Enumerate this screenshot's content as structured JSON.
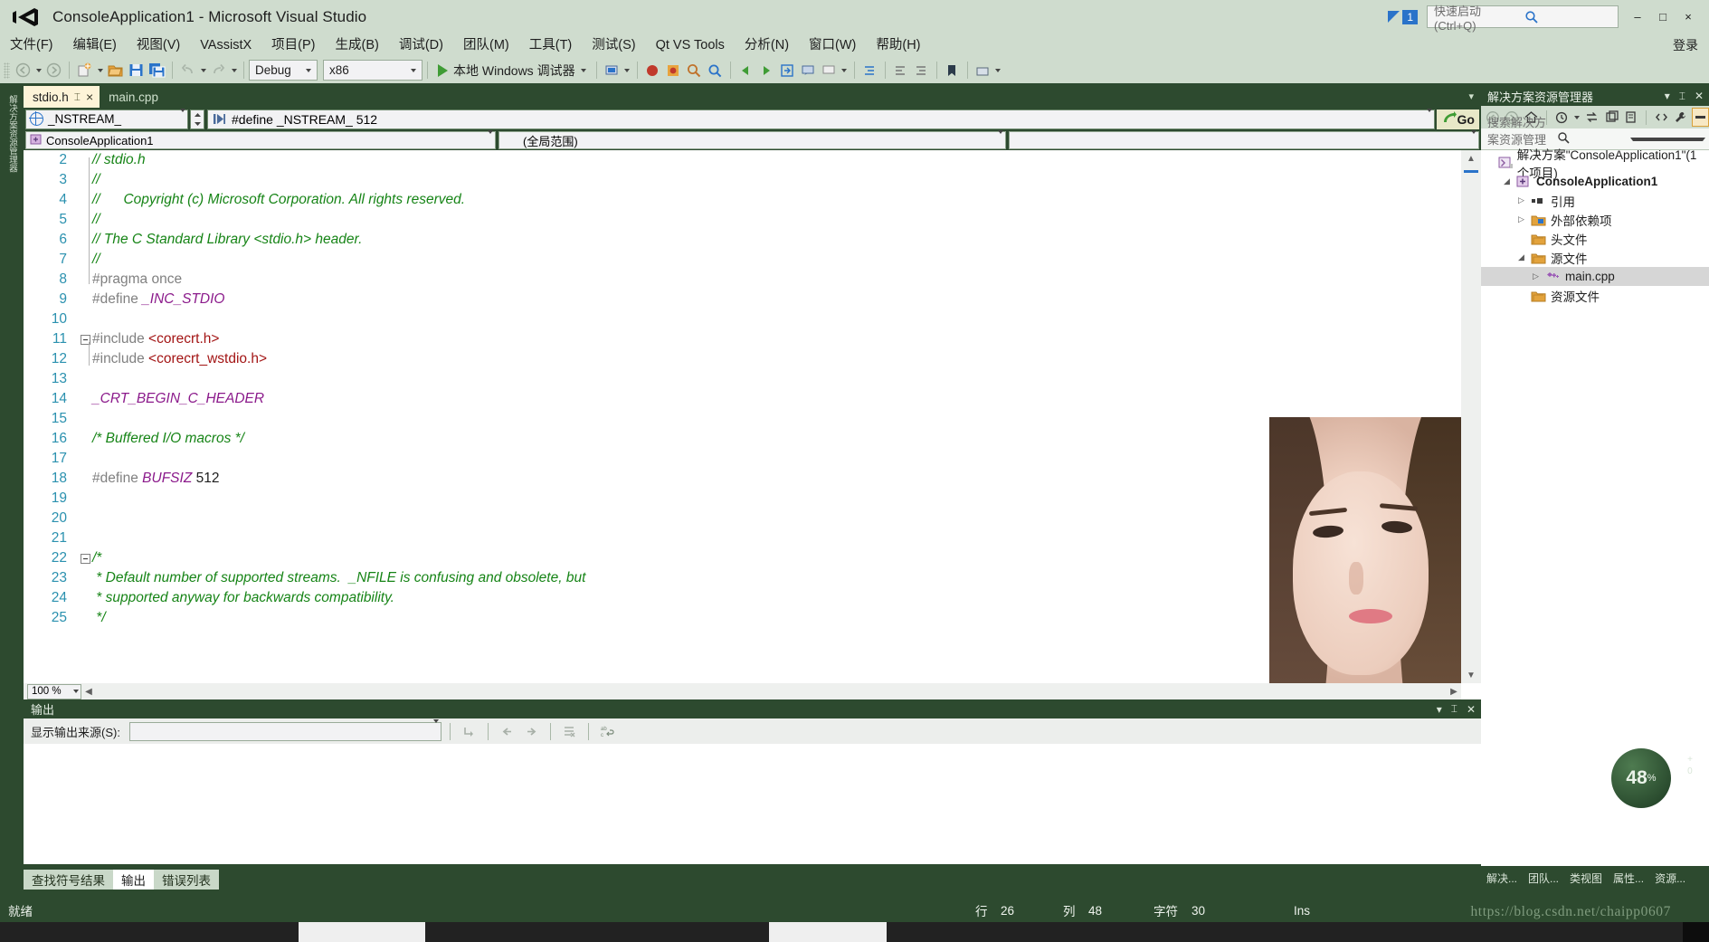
{
  "window": {
    "title": "ConsoleApplication1 - Microsoft Visual Studio",
    "logo_name": "visual-studio-logo",
    "notification_count": "1",
    "minimize": "–",
    "maximize": "□",
    "close": "×",
    "signin": "登录"
  },
  "quick_launch": {
    "placeholder": "快速启动 (Ctrl+Q)",
    "icon": "search-icon"
  },
  "menu": {
    "items": [
      "文件(F)",
      "编辑(E)",
      "视图(V)",
      "VAssistX",
      "项目(P)",
      "生成(B)",
      "调试(D)",
      "团队(M)",
      "工具(T)",
      "测试(S)",
      "Qt VS Tools",
      "分析(N)",
      "窗口(W)",
      "帮助(H)"
    ]
  },
  "toolbar": {
    "config": "Debug",
    "platform": "x86",
    "run_label": "本地 Windows 调试器",
    "icons": [
      "back-icon",
      "forward-icon",
      "new-project-icon",
      "open-file-icon",
      "save-icon",
      "save-all-icon",
      "undo-icon",
      "redo-icon"
    ]
  },
  "doc_tabs": [
    {
      "label": "stdio.h",
      "active": true,
      "pin": "pin-icon",
      "close": "×"
    },
    {
      "label": "main.cpp",
      "active": false
    }
  ],
  "vertical_tab_label": "解决方案资源管理器",
  "navbar": {
    "symbol": "_NSTREAM_",
    "definition": "#define _NSTREAM_ 512",
    "go_label": "Go",
    "project": "ConsoleApplication1",
    "scope": "(全局范围)"
  },
  "editor": {
    "zoom": "100 %",
    "lines": [
      {
        "no": "2",
        "fold": "",
        "parts": [
          {
            "t": "// stdio.h",
            "c": "c-comment"
          }
        ]
      },
      {
        "no": "3",
        "fold": "",
        "parts": [
          {
            "t": "//",
            "c": "c-comment"
          }
        ]
      },
      {
        "no": "4",
        "fold": "",
        "parts": [
          {
            "t": "//      Copyright (c) Microsoft Corporation. All rights reserved.",
            "c": "c-comment"
          }
        ]
      },
      {
        "no": "5",
        "fold": "",
        "parts": [
          {
            "t": "//",
            "c": "c-comment"
          }
        ]
      },
      {
        "no": "6",
        "fold": "",
        "parts": [
          {
            "t": "// The C Standard Library <stdio.h> header.",
            "c": "c-comment"
          }
        ]
      },
      {
        "no": "7",
        "fold": "",
        "parts": [
          {
            "t": "//",
            "c": "c-comment"
          }
        ]
      },
      {
        "no": "8",
        "fold": "",
        "parts": [
          {
            "t": "#pragma once",
            "c": "c-pre"
          }
        ]
      },
      {
        "no": "9",
        "fold": "",
        "parts": [
          {
            "t": "#define ",
            "c": "c-pre"
          },
          {
            "t": "_INC_STDIO",
            "c": "c-macro"
          }
        ]
      },
      {
        "no": "10",
        "fold": "",
        "parts": []
      },
      {
        "no": "11",
        "fold": "⊖",
        "parts": [
          {
            "t": "#include ",
            "c": "c-pre"
          },
          {
            "t": "<corecrt.h>",
            "c": "c-str"
          }
        ]
      },
      {
        "no": "12",
        "fold": "",
        "parts": [
          {
            "t": "#include ",
            "c": "c-pre"
          },
          {
            "t": "<corecrt_wstdio.h>",
            "c": "c-str"
          }
        ]
      },
      {
        "no": "13",
        "fold": "",
        "parts": []
      },
      {
        "no": "14",
        "fold": "",
        "parts": [
          {
            "t": "_CRT_BEGIN_C_HEADER",
            "c": "c-macro"
          }
        ]
      },
      {
        "no": "15",
        "fold": "",
        "parts": []
      },
      {
        "no": "16",
        "fold": "",
        "parts": [
          {
            "t": "/* Buffered I/O macros */",
            "c": "c-comment"
          }
        ]
      },
      {
        "no": "17",
        "fold": "",
        "parts": []
      },
      {
        "no": "18",
        "fold": "",
        "parts": [
          {
            "t": "#define ",
            "c": "c-pre"
          },
          {
            "t": "BUFSIZ",
            "c": "c-macro"
          },
          {
            "t": " 512",
            "c": "c-num"
          }
        ]
      },
      {
        "no": "19",
        "fold": "",
        "parts": []
      },
      {
        "no": "20",
        "fold": "",
        "parts": []
      },
      {
        "no": "21",
        "fold": "",
        "parts": []
      },
      {
        "no": "22",
        "fold": "⊖",
        "parts": [
          {
            "t": "/*",
            "c": "c-comment"
          }
        ]
      },
      {
        "no": "23",
        "fold": "",
        "parts": [
          {
            "t": " * Default number of supported streams.  _NFILE is confusing and obsolete, but",
            "c": "c-comment"
          }
        ]
      },
      {
        "no": "24",
        "fold": "",
        "parts": [
          {
            "t": " * supported anyway for backwards compatibility.",
            "c": "c-comment"
          }
        ]
      },
      {
        "no": "25",
        "fold": "",
        "parts": [
          {
            "t": " */",
            "c": "c-comment"
          }
        ]
      }
    ]
  },
  "output": {
    "title": "输出",
    "source_label": "显示输出来源(S):",
    "source_value": "",
    "tabs": [
      {
        "label": "查找符号结果",
        "active": false
      },
      {
        "label": "输出",
        "active": true
      },
      {
        "label": "错误列表",
        "active": false
      }
    ],
    "toolbar_icons": [
      "jump-to-icon",
      "prev-icon",
      "next-icon",
      "clear-all-icon",
      "word-wrap-icon"
    ]
  },
  "solution_explorer": {
    "title": "解决方案资源管理器",
    "search_placeholder": "搜索解决方案资源管理器(Ctrl+;)",
    "toolbar_icons": [
      "back-icon",
      "forward-icon",
      "home-icon",
      "pending-changes-icon",
      "sync-icon",
      "collapse-all-icon",
      "properties-icon",
      "show-all-files-icon",
      "wrench-icon",
      "preview-icon"
    ],
    "tree": [
      {
        "label": "解决方案\"ConsoleApplication1\"(1 个项目)",
        "indent": 0,
        "twisty": "",
        "icon": "solution-icon",
        "bold": false,
        "selected": false
      },
      {
        "label": "ConsoleApplication1",
        "indent": 1,
        "twisty": "◢",
        "icon": "project-icon",
        "bold": true,
        "selected": false
      },
      {
        "label": "引用",
        "indent": 2,
        "twisty": "▷",
        "icon": "references-icon",
        "bold": false,
        "selected": false
      },
      {
        "label": "外部依赖项",
        "indent": 2,
        "twisty": "▷",
        "icon": "ext-deps-icon",
        "bold": false,
        "selected": false
      },
      {
        "label": "头文件",
        "indent": 2,
        "twisty": "",
        "icon": "folder-icon",
        "bold": false,
        "selected": false
      },
      {
        "label": "源文件",
        "indent": 2,
        "twisty": "◢",
        "icon": "folder-icon",
        "bold": false,
        "selected": false
      },
      {
        "label": "main.cpp",
        "indent": 3,
        "twisty": "▷",
        "icon": "cpp-file-icon",
        "bold": false,
        "selected": true
      },
      {
        "label": "资源文件",
        "indent": 2,
        "twisty": "",
        "icon": "folder-icon",
        "bold": false,
        "selected": false
      }
    ],
    "bottom_tabs": [
      "解决...",
      "团队...",
      "类视图",
      "属性...",
      "资源..."
    ]
  },
  "status_bar": {
    "ready": "就绪",
    "line_label": "行",
    "line_value": "26",
    "col_label": "列",
    "col_value": "48",
    "char_label": "字符",
    "char_value": "30",
    "insert_mode": "Ins"
  },
  "watermark": "https://blog.csdn.net/chaipp0607",
  "zoom_widget": {
    "value": "48",
    "unit": "%"
  },
  "colors": {
    "chrome": "#cfdcce",
    "dark_green": "#2d4a2f",
    "accent_blue": "#2a73c9",
    "comment_green": "#168416",
    "macro_purple": "#8b1a8b",
    "string_red": "#a31515",
    "lineno_blue": "#2b91af",
    "tab_active": "#fdf4d8"
  }
}
